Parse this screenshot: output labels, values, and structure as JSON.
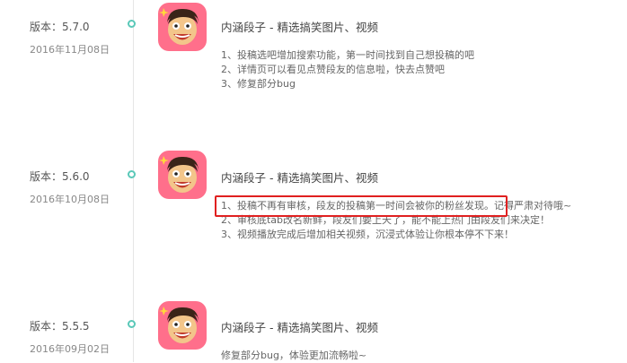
{
  "colors": {
    "accent_teal": "#5ac8b8",
    "icon_bg": "#ff6f8b",
    "highlight": "#e02020"
  },
  "releases": [
    {
      "version": "版本：5.7.0",
      "date": "2016年11月08日",
      "app_title": "内涵段子 - 精选搞笑图片、视频",
      "notes": [
        "1、投稿选吧增加搜索功能，第一时间找到自己想投稿的吧",
        "2、详情页可以看见点赞段友的信息啦，快去点赞吧",
        "3、修复部分bug"
      ]
    },
    {
      "version": "版本：5.6.0",
      "date": "2016年10月08日",
      "app_title": "内涵段子 - 精选搞笑图片、视频",
      "notes": [
        "1、投稿不再有审核，段友的投稿第一时间会被你的粉丝发现。记得严肃对待哦~",
        "2、审核底tab改名新鲜，段友们要上天了，能不能上热门由段友们来决定！",
        "3、视频播放完成后增加相关视频，沉浸式体验让你根本停不下来！"
      ]
    },
    {
      "version": "版本：5.5.5",
      "date": "2016年09月02日",
      "app_title": "内涵段子 - 精选搞笑图片、视频",
      "notes": [
        "修复部分bug，体验更加流畅啦~"
      ]
    }
  ]
}
